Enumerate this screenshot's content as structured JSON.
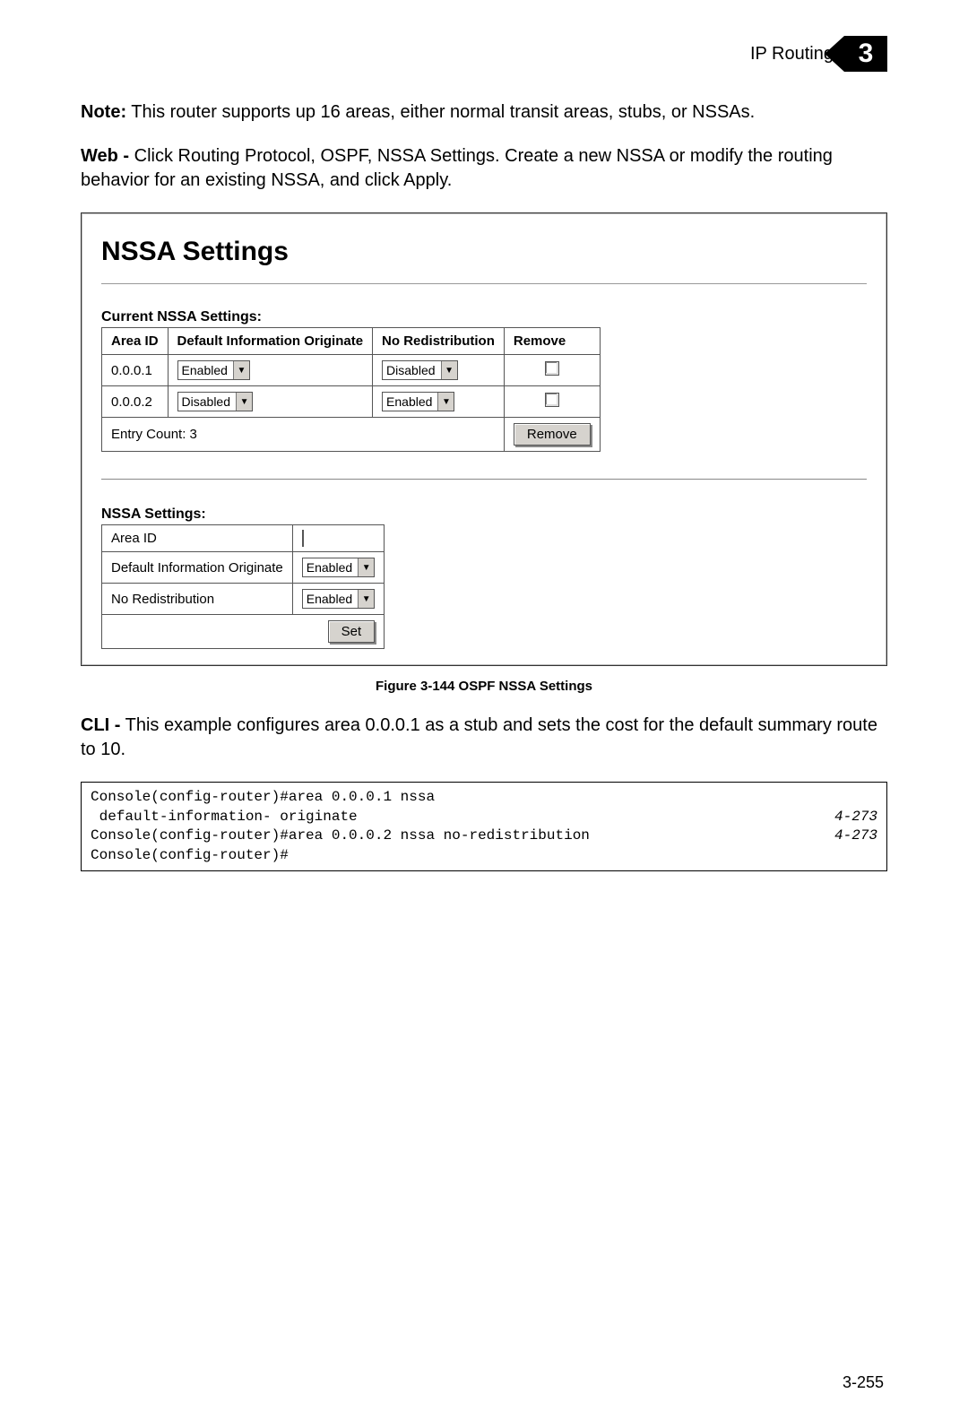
{
  "header": {
    "section": "IP Routing",
    "chapter": "3"
  },
  "note": {
    "label": "Note:",
    "text": " This router supports up 16 areas, either normal transit areas, stubs, or NSSAs."
  },
  "web": {
    "label": "Web -",
    "text": " Click Routing Protocol, OSPF, NSSA Settings. Create a new NSSA or modify the routing behavior for an existing NSSA, and click Apply."
  },
  "figure": {
    "title": "NSSA Settings",
    "current_label": "Current NSSA Settings:",
    "headers": {
      "area": "Area ID",
      "dio": "Default Information Originate",
      "nor": "No Redistribution",
      "rem": "Remove"
    },
    "rows": [
      {
        "area": "0.0.0.1",
        "dio": "Enabled",
        "nor": "Disabled"
      },
      {
        "area": "0.0.0.2",
        "dio": "Disabled",
        "nor": "Enabled"
      }
    ],
    "entry_count": "Entry Count: 3",
    "remove_btn": "Remove",
    "form_label": "NSSA Settings:",
    "form": {
      "area_label": "Area ID",
      "dio_label": "Default Information Originate",
      "dio_value": "Enabled",
      "nor_label": "No Redistribution",
      "nor_value": "Enabled",
      "set_btn": "Set"
    }
  },
  "caption": "Figure 3-144   OSPF NSSA Settings",
  "cli": {
    "label": "CLI -",
    "text": " This example configures area 0.0.0.1 as a stub and sets the cost for the default summary route to 10.",
    "lines_left": "Console(config-router)#area 0.0.0.1 nssa\n default-information- originate\nConsole(config-router)#area 0.0.0.2 nssa no-redistribution\nConsole(config-router)#",
    "lines_right": "\n4-273\n4-273\n"
  },
  "page_number": "3-255"
}
